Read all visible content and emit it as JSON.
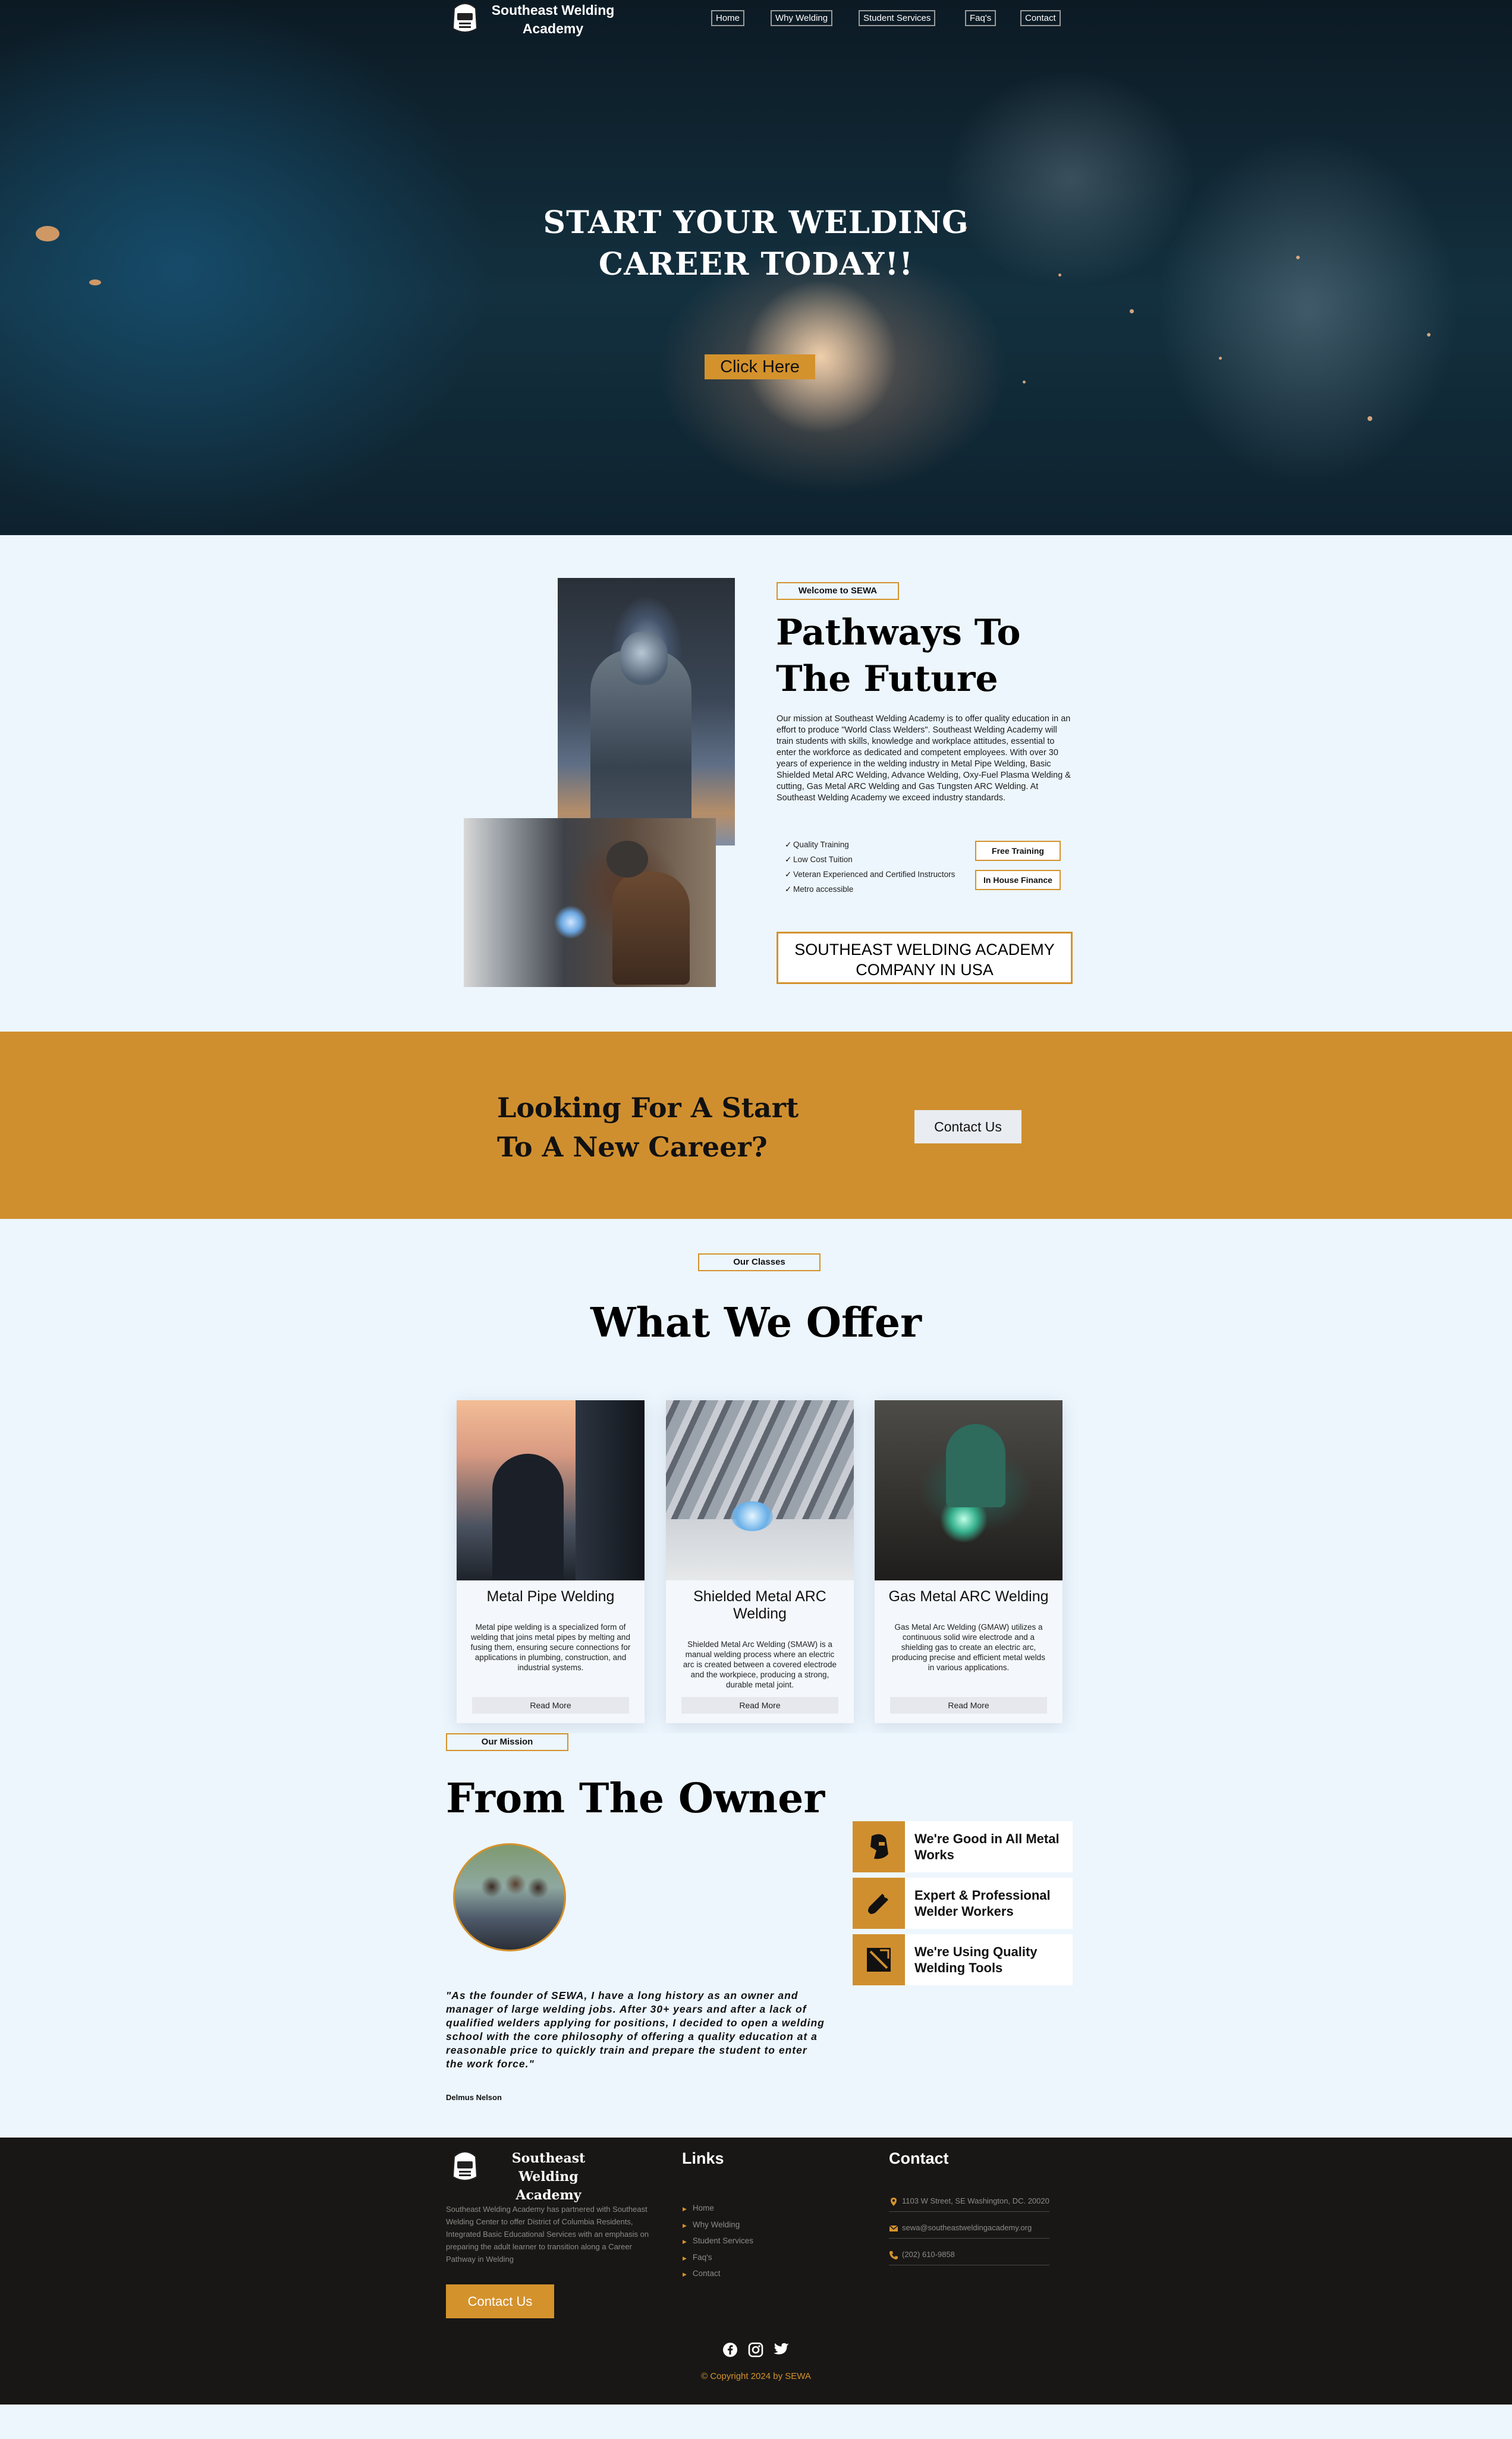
{
  "brand": {
    "name": "Southeast Welding Academy"
  },
  "nav": {
    "items": [
      {
        "label": "Home"
      },
      {
        "label": "Why Welding"
      },
      {
        "label": "Student Services"
      },
      {
        "label": "Faq's"
      },
      {
        "label": "Contact"
      }
    ]
  },
  "hero": {
    "title_line1": "START YOUR WELDING",
    "title_line2": "CAREER TODAY!!",
    "button": "Click Here"
  },
  "welcome": {
    "tag": "Welcome to SEWA",
    "title_line1": "Pathways To",
    "title_line2": "The Future",
    "paragraph": "Our mission at Southeast Welding Academy is to offer quality education in an effort to produce \"World Class Welders\". Southeast Welding Academy will train students with skills, knowledge and workplace attitudes, essential to enter the workforce as dedicated and competent employees. With over 30 years of experience in the welding industry in Metal Pipe Welding, Basic Shielded Metal ARC Welding, Advance Welding, Oxy-Fuel Plasma Welding & cutting, Gas Metal ARC Welding and Gas Tungsten ARC Welding. At Southeast Welding Academy we exceed industry standards.",
    "checklist": [
      "Quality Training",
      "Low Cost Tuition",
      "Veteran Experienced and Certified Instructors",
      "Metro accessible"
    ],
    "badge_free": "Free Training",
    "badge_finance": "In House Finance",
    "company_line1": "SOUTHEAST WELDING ACADEMY",
    "company_line2": "COMPANY IN USA"
  },
  "cta": {
    "title_line1": "Looking For A Start",
    "title_line2": "To A New Career?",
    "button": "Contact Us"
  },
  "offer": {
    "tag": "Our Classes",
    "title": "What We Offer",
    "cards": [
      {
        "title": "Metal Pipe Welding",
        "text": "Metal pipe welding is a specialized form of welding that joins metal pipes by melting and fusing them, ensuring secure connections for applications in plumbing, construction, and industrial systems.",
        "button": "Read More"
      },
      {
        "title": "Shielded Metal ARC Welding",
        "text": "Shielded Metal Arc Welding (SMAW) is a manual welding process where an electric arc is created between a covered electrode and the workpiece, producing a strong, durable metal joint.",
        "button": "Read More"
      },
      {
        "title": "Gas Metal ARC Welding",
        "text": "Gas Metal Arc Welding (GMAW) utilizes a continuous solid wire electrode and a shielding gas to create an electric arc, producing precise and efficient metal welds in various applications.",
        "button": "Read More"
      }
    ]
  },
  "owner": {
    "tag": "Our Mission",
    "title": "From The Owner",
    "quote": "\"As the founder of SEWA, I have a long history as an owner and manager of large welding jobs. After 30+ years and after a lack of qualified welders applying for positions, I decided to open a welding school with the core philosophy of offering a quality education at a reasonable price to quickly train and prepare the student to enter the work force.\"",
    "signature": "Delmus Nelson",
    "features": [
      {
        "text": "We're Good in All Metal Works",
        "icon": "welding-helmet-icon"
      },
      {
        "text": "Expert & Professional Welder Workers",
        "icon": "torch-icon"
      },
      {
        "text": "We're Using Quality Welding Tools",
        "icon": "welder-tool-icon"
      }
    ]
  },
  "footer": {
    "brand": "Southeast Welding Academy",
    "description": "Southeast Welding Academy has partnered with Southeast Welding Center to offer District of Columbia Residents, Integrated Basic Educational Services with an emphasis on preparing the adult learner to transition along a Career Pathway in Welding",
    "button": "Contact Us",
    "links_title": "Links",
    "links": [
      "Home",
      "Why Welding",
      "Student Services",
      "Faq's",
      "Contact"
    ],
    "contact_title": "Contact",
    "address": "1103 W Street, SE Washington, DC. 20020",
    "email": "sewa@southeastweldingacademy.org",
    "phone": "(202) 610-9858",
    "social": [
      "facebook-icon",
      "instagram-icon",
      "twitter-icon"
    ],
    "copyright": "© Copyright 2024 by SEWA"
  },
  "colors": {
    "accent": "#d08f2f",
    "background": "#edf6fd",
    "footer": "#181715"
  }
}
